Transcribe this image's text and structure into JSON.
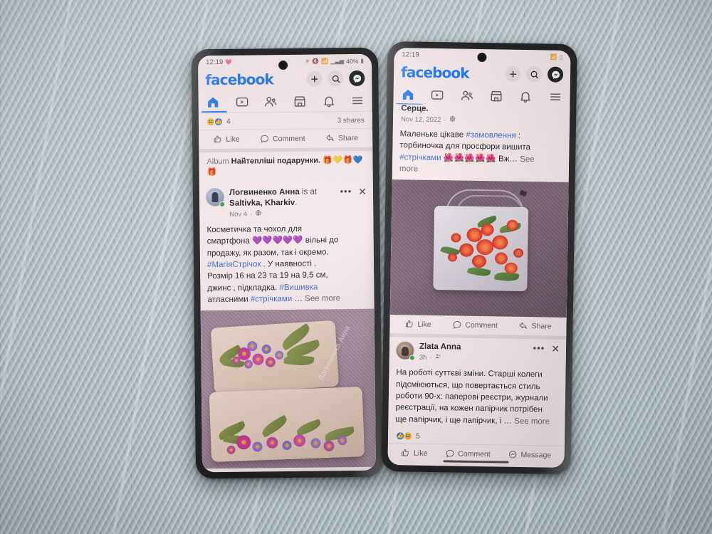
{
  "scene": {
    "background_color": "#aab7bf",
    "description": "two-phones-on-woven-mat"
  },
  "left_phone": {
    "status_bar": {
      "time": "12:19",
      "time_icon": "heart-icon",
      "icons": [
        "bluetooth-icon",
        "mute-icon",
        "wifi-icon",
        "signal-icon"
      ],
      "battery_percent": "40%",
      "battery_icon": "battery-icon"
    },
    "app_header": {
      "logo": "facebook",
      "logo_color": "#1877f2",
      "actions": [
        {
          "name": "add-button",
          "icon": "plus-icon"
        },
        {
          "name": "search-button",
          "icon": "search-icon"
        },
        {
          "name": "messenger-button",
          "icon": "messenger-icon"
        }
      ]
    },
    "tabs": [
      {
        "name": "tab-home",
        "icon": "home-icon",
        "active": true
      },
      {
        "name": "tab-video",
        "icon": "video-icon",
        "active": false
      },
      {
        "name": "tab-friends",
        "icon": "friends-icon",
        "active": false
      },
      {
        "name": "tab-marketplace",
        "icon": "marketplace-icon",
        "active": false
      },
      {
        "name": "tab-notifications",
        "icon": "bell-icon",
        "active": false
      },
      {
        "name": "tab-menu",
        "icon": "hamburger-icon",
        "active": false
      }
    ],
    "prev_post_footer": {
      "reaction_count": "4",
      "reactions": [
        "haha-icon",
        "like-icon"
      ],
      "shares": "3 shares",
      "actions": [
        {
          "label": "Like",
          "icon": "thumbs-up-icon"
        },
        {
          "label": "Comment",
          "icon": "comment-bubble-icon"
        },
        {
          "label": "Share",
          "icon": "share-arrow-icon"
        }
      ]
    },
    "album_row": {
      "keyword": "Album",
      "title": "Найтепліші подарунки.",
      "emoji": "🎁💛🎁💙",
      "emoji_wrapped": "🎁"
    },
    "post": {
      "author": "Логвиненко Анна",
      "connector": "is",
      "action_prefix": "at",
      "location": "Saltivka, Kharkiv",
      "location_suffix": ".",
      "timestamp": "Nov 4",
      "privacy_icon": "globe-icon",
      "more_icon": "ellipsis-icon",
      "close_icon": "close-icon",
      "body_lines": [
        "Косметичка та чохол для",
        "смартфона 💜💜💜💜💜 вільні до",
        "продажу, як разом, так і окремо.",
        "#МагіяСтрічок . У наявності .",
        "Розмір 16 на 23 та 19 на 9,5 см,",
        "джинс , підкладка. #Вишивка",
        "атласними #стрічками … See more"
      ],
      "tags": [
        "#МагіяСтрічок",
        "#Вишивка",
        "#стрічками"
      ],
      "see_more": "See more",
      "photo_alt": "two embroidered pouches with pink and purple ribbon flowers",
      "photo_watermark": "Логвиненко Анна"
    }
  },
  "right_phone": {
    "status_bar": {
      "time": "12:19",
      "icons": [
        "wifi-icon",
        "battery-icon"
      ]
    },
    "app_header": {
      "logo": "facebook",
      "logo_color": "#1877f2",
      "actions": [
        {
          "name": "add-button",
          "icon": "plus-icon"
        },
        {
          "name": "search-button",
          "icon": "search-icon"
        },
        {
          "name": "messenger-button",
          "icon": "messenger-icon"
        }
      ]
    },
    "tabs": [
      {
        "name": "tab-home",
        "icon": "home-icon",
        "active": true
      },
      {
        "name": "tab-video",
        "icon": "video-icon",
        "active": false
      },
      {
        "name": "tab-friends",
        "icon": "friends-icon",
        "active": false
      },
      {
        "name": "tab-marketplace",
        "icon": "marketplace-icon",
        "active": false
      },
      {
        "name": "tab-notifications",
        "icon": "bell-icon",
        "active": false
      },
      {
        "name": "tab-menu",
        "icon": "hamburger-icon",
        "active": false
      }
    ],
    "post_top": {
      "author_partial": "Серце.",
      "timestamp": "Nov 12, 2022",
      "privacy_icon": "globe-icon",
      "body_lines": [
        "Маленьке цікаве #замовлення :",
        "торбиночка для просфори вишита",
        "#стрічками 🌺🌺🌺🌺🌺 Вж… See",
        "more"
      ],
      "tags": [
        "#замовлення",
        "#стрічками"
      ],
      "see_more": "See more",
      "photo_alt": "grey drawstring pouch embroidered with red ribbon roses",
      "actions": [
        {
          "label": "Like",
          "icon": "thumbs-up-icon"
        },
        {
          "label": "Comment",
          "icon": "comment-bubble-icon"
        },
        {
          "label": "Share",
          "icon": "share-arrow-icon"
        }
      ]
    },
    "post_bottom": {
      "author": "Zlata Anna",
      "timestamp": "3h",
      "privacy_icon": "friends-icon",
      "more_icon": "ellipsis-icon",
      "close_icon": "close-icon",
      "body_lines": [
        "На роботі суттєві зміни. Старші колеги",
        "підсміюються, що повертається стиль",
        "роботи 90-х: паперові реєстри, журнали",
        "реєстрації, на кожен папірчик потрібен",
        "ще папірчик, і ще папірчик, і … See more"
      ],
      "see_more": "See more",
      "reaction_count": "5",
      "reactions": [
        "like-icon",
        "haha-icon"
      ],
      "actions": [
        {
          "label": "Like",
          "icon": "thumbs-up-icon"
        },
        {
          "label": "Comment",
          "icon": "comment-bubble-icon"
        },
        {
          "label": "Message",
          "icon": "messenger-icon"
        }
      ]
    },
    "home_indicator": true
  }
}
